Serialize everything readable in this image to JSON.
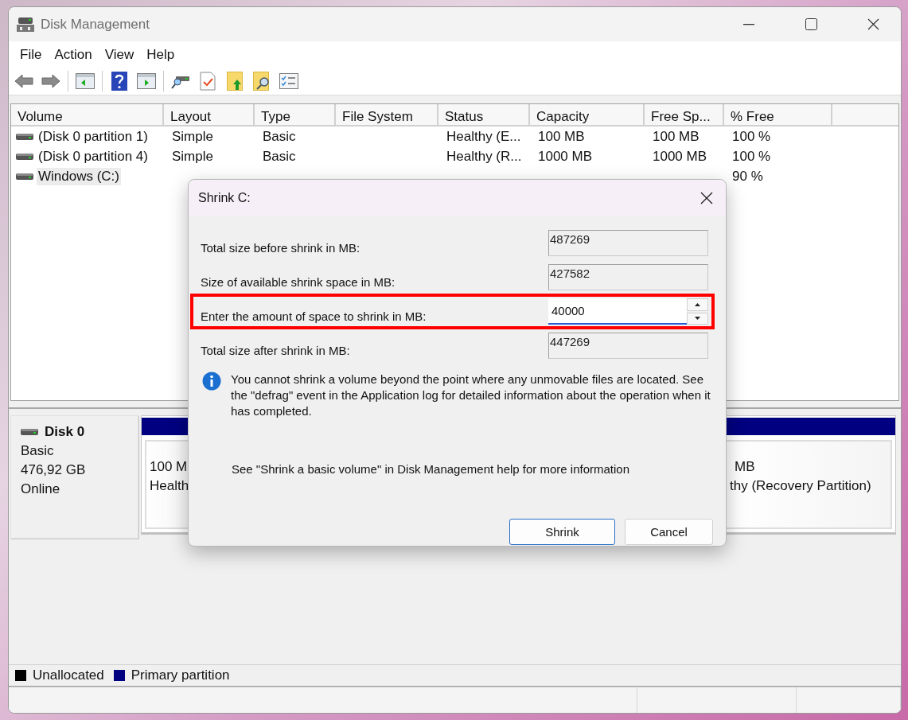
{
  "window": {
    "title": "Disk Management"
  },
  "menu": [
    {
      "label": "File"
    },
    {
      "label": "Action"
    },
    {
      "label": "View"
    },
    {
      "label": "Help"
    }
  ],
  "table": {
    "columns": [
      "Volume",
      "Layout",
      "Type",
      "File System",
      "Status",
      "Capacity",
      "Free Sp...",
      "% Free"
    ],
    "rows": [
      {
        "selected": false,
        "volume": "(Disk 0 partition 1)",
        "layout": "Simple",
        "type": "Basic",
        "status": "Healthy (E...",
        "capacity": "100 MB",
        "free_space": "100 MB",
        "percent_free": "100 %"
      },
      {
        "selected": false,
        "volume": "(Disk 0 partition 4)",
        "layout": "Simple",
        "type": "Basic",
        "status": "Healthy (R...",
        "capacity": "1000 MB",
        "free_space": "1000 MB",
        "percent_free": "100 %"
      },
      {
        "selected": true,
        "volume": "Windows (C:)",
        "percent_free": "90 %"
      }
    ]
  },
  "disk": {
    "name": "Disk 0",
    "type": "Basic",
    "size": "476,92 GB",
    "status": "Online",
    "partitions": [
      {
        "lines": [
          "100 M",
          "Health"
        ]
      },
      {
        "lines": [
          "MB",
          "thy (Recovery Partition)"
        ]
      }
    ]
  },
  "legend": [
    {
      "label": "Unallocated",
      "color": "#000000"
    },
    {
      "label": "Primary partition",
      "color": "#000080"
    }
  ],
  "dialog": {
    "title": "Shrink C:",
    "fields": [
      {
        "kind": "readonly",
        "label": "Total size before shrink in MB:",
        "value": "487269",
        "highlighted": false
      },
      {
        "kind": "readonly",
        "label": "Size of available shrink space in MB:",
        "value": "427582",
        "highlighted": false
      },
      {
        "kind": "spin",
        "label": "Enter the amount of space to shrink in MB:",
        "value": "40000",
        "highlighted": true
      },
      {
        "kind": "readonly",
        "label": "Total size after shrink in MB:",
        "value": "447269",
        "highlighted": false
      }
    ],
    "info": "You cannot shrink a volume beyond the point where any unmovable files are located. See the \"defrag\" event in the Application log for detailed information about the operation when it has completed.",
    "help": "See \"Shrink a basic volume\" in Disk Management help for more information",
    "buttons": [
      {
        "label": "Shrink",
        "default": true
      },
      {
        "label": "Cancel",
        "default": false
      }
    ]
  }
}
